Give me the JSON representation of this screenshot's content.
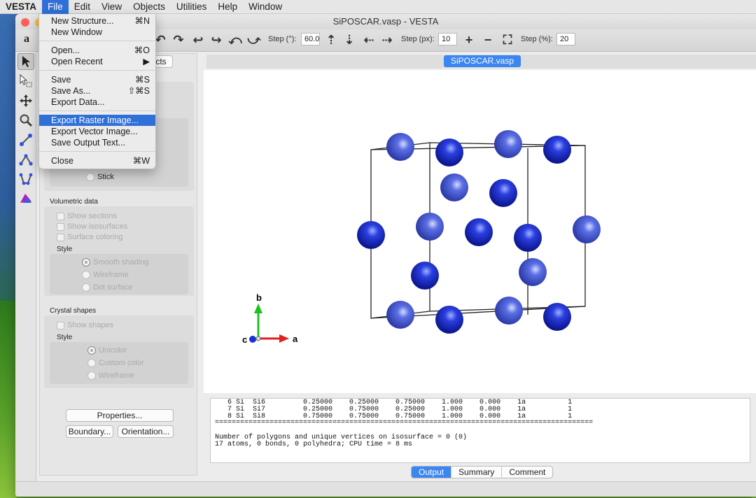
{
  "menubar": {
    "app": "VESTA",
    "items": [
      "File",
      "Edit",
      "View",
      "Objects",
      "Utilities",
      "Help",
      "Window"
    ],
    "active": "File"
  },
  "window": {
    "title": "SiPOSCAR.vasp - VESTA"
  },
  "toolbar": {
    "mode_label": "a",
    "step_deg_label": "Step (°):",
    "step_deg_value": "60.0",
    "step_px_label": "Step (px):",
    "step_px_value": "10",
    "step_pct_label": "Step (%):",
    "step_pct_value": "20"
  },
  "file_menu": {
    "items": [
      {
        "label": "New Structure...",
        "shortcut": "⌘N"
      },
      {
        "label": "New Window",
        "shortcut": ""
      },
      {
        "label": "Open...",
        "shortcut": "⌘O"
      },
      {
        "label": "Open Recent",
        "shortcut": "▶"
      },
      {
        "label": "Save",
        "shortcut": "⌘S"
      },
      {
        "label": "Save As...",
        "shortcut": "⇧⌘S"
      },
      {
        "label": "Export Data...",
        "shortcut": ""
      },
      {
        "label": "Export Raster Image...",
        "shortcut": ""
      },
      {
        "label": "Export Vector Image...",
        "shortcut": ""
      },
      {
        "label": "Save Output Text...",
        "shortcut": ""
      },
      {
        "label": "Close",
        "shortcut": "⌘W"
      }
    ],
    "highlighted": "Export Raster Image..."
  },
  "side_panel": {
    "objects_tab_fragment": "cts",
    "stick_label": "Stick",
    "volumetric": {
      "title": "Volumetric data",
      "checks": [
        "Show sections",
        "Show isosurfaces",
        "Surface coloring"
      ],
      "style_label": "Style",
      "radios": [
        "Smooth shading",
        "Wireframe",
        "Dot surface"
      ]
    },
    "crystal_shapes": {
      "title": "Crystal shapes",
      "check": "Show shapes",
      "style_label": "Style",
      "radios": [
        "Unicolor",
        "Custom color",
        "Wireframe"
      ]
    },
    "buttons": {
      "properties": "Properties...",
      "boundary": "Boundary...",
      "orientation": "Orientation..."
    }
  },
  "viewer": {
    "tab": "SiPOSCAR.vasp",
    "axes": {
      "a": "a",
      "b": "b",
      "c": "c"
    },
    "colors": {
      "atom": "#2233cc",
      "axis_a": "#e02020",
      "axis_b": "#20c020",
      "axis_c": "#1a2fd0"
    }
  },
  "output": {
    "lines": [
      "   6 Si  Si6         0.25000    0.25000    0.75000    1.000    0.000    1a          1",
      "   7 Si  Si7         0.25000    0.75000    0.25000    1.000    0.000    1a          1",
      "   8 Si  Si8         0.75000    0.75000    0.75000    1.000    0.000    1a          1",
      "==========================================================================================",
      "",
      "Number of polygons and unique vertices on isosurface = 0 (0)",
      "17 atoms, 0 bonds, 0 polyhedra; CPU time = 8 ms"
    ],
    "tabs": [
      "Output",
      "Summary",
      "Comment"
    ],
    "active_tab": "Output"
  }
}
